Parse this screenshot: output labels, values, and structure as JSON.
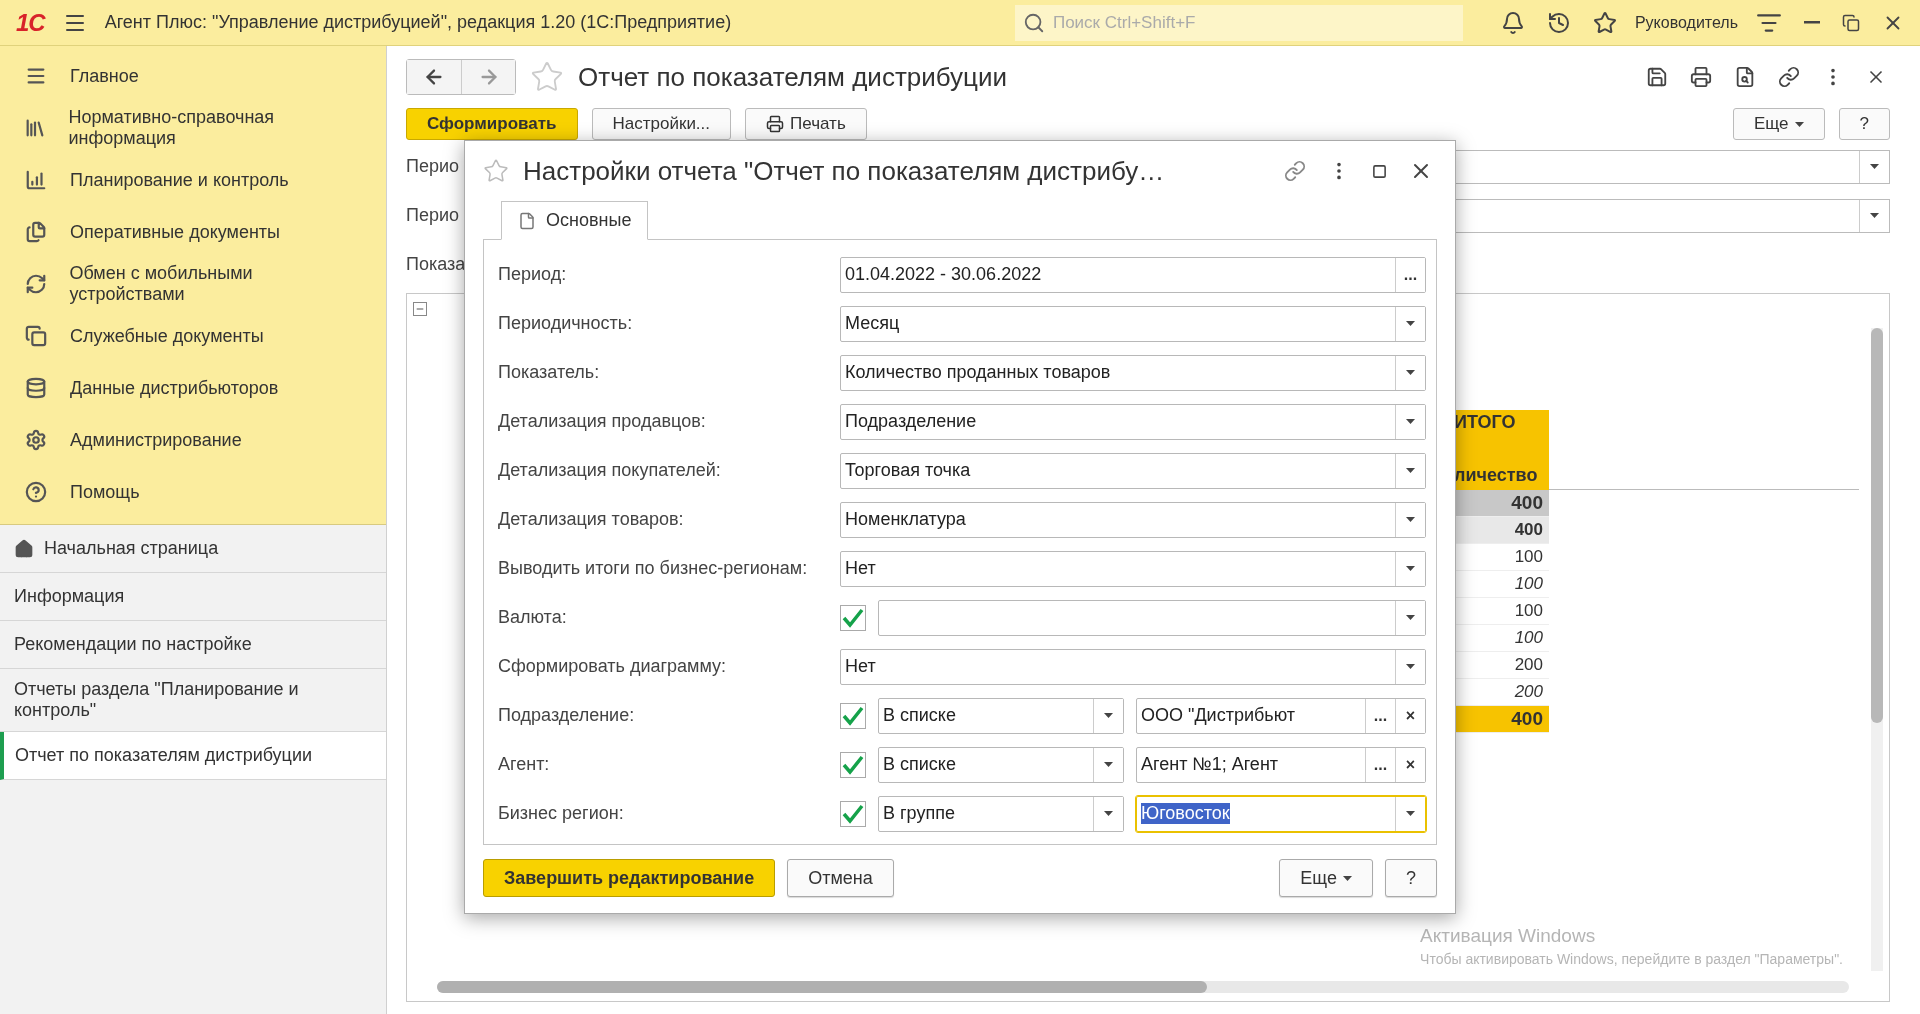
{
  "app": {
    "logo": "1С",
    "title": "Агент Плюс: \"Управление дистрибуцией\", редакция 1.20  (1С:Предприятие)",
    "search": {
      "placeholder": "Поиск Ctrl+Shift+F"
    },
    "user": "Руководитель"
  },
  "sidebar": {
    "sections": [
      {
        "label": "Главное",
        "kind": "menu"
      },
      {
        "label": "Нормативно-справочная информация",
        "kind": "catalog"
      },
      {
        "label": "Планирование и контроль",
        "kind": "chart"
      },
      {
        "label": "Оперативные документы",
        "kind": "docs"
      },
      {
        "label": "Обмен с мобильными устройствами",
        "kind": "sync"
      },
      {
        "label": "Служебные документы",
        "kind": "service"
      },
      {
        "label": "Данные дистрибьюторов",
        "kind": "data"
      },
      {
        "label": "Администрирование",
        "kind": "gear"
      },
      {
        "label": "Помощь",
        "kind": "help"
      }
    ],
    "open_windows": [
      {
        "label": "Начальная страница",
        "kind": "home",
        "selected": false
      },
      {
        "label": "Информация",
        "kind": "plain",
        "selected": false
      },
      {
        "label": "Рекомендации по настройке",
        "kind": "plain",
        "selected": false
      },
      {
        "label": "Отчеты раздела \"Планирование и контроль\"",
        "kind": "plain",
        "selected": false
      },
      {
        "label": "Отчет по показателям дистрибуции",
        "kind": "plain",
        "selected": true
      }
    ]
  },
  "form": {
    "title": "Отчет по показателям дистрибуции",
    "toolbar": [
      {
        "label": "Сформировать",
        "kind": "primary"
      },
      {
        "label": "Настройки...",
        "kind": "plain"
      },
      {
        "label": "Печать",
        "kind": "print"
      }
    ],
    "more": "Еще",
    "help": "?",
    "parameters": [
      {
        "label": "Перио",
        "kind": "select"
      },
      {
        "label": "Перио",
        "kind": "select"
      },
      {
        "label": "Показа",
        "kind": "text"
      }
    ],
    "report": {
      "total_header": "ИТОГО",
      "quantity_header": "личество",
      "rows": [
        {
          "value": "400",
          "kind": "total"
        },
        {
          "value": "400",
          "kind": "group"
        },
        {
          "value": "100",
          "kind": "plain"
        },
        {
          "value": "100",
          "kind": "italic"
        },
        {
          "value": "100",
          "kind": "plain"
        },
        {
          "value": "100",
          "kind": "italic"
        },
        {
          "value": "200",
          "kind": "plain"
        },
        {
          "value": "200",
          "kind": "italic"
        },
        {
          "value": "400",
          "kind": "grand"
        }
      ]
    }
  },
  "dialog": {
    "title": "Настройки отчета \"Отчет по показателям дистрибу…",
    "tabs": [
      {
        "label": "Основные",
        "selected": true
      }
    ],
    "rows": [
      {
        "label": "Период:",
        "kind": "field",
        "value": "01.04.2022 - 30.06.2022",
        "button_text": "..."
      },
      {
        "label": "Периодичность:",
        "kind": "field",
        "value": "Месяц"
      },
      {
        "label": "Показатель:",
        "kind": "field",
        "value": "Количество проданных товаров"
      },
      {
        "label": "Детализация продавцов:",
        "kind": "field",
        "value": "Подразделение"
      },
      {
        "label": "Детализация покупателей:",
        "kind": "field",
        "value": "Торговая точка"
      },
      {
        "label": "Детализация товаров:",
        "kind": "field",
        "value": "Номенклатура"
      },
      {
        "label": "Выводить итоги по бизнес-регионам:",
        "kind": "field",
        "value": "Нет"
      },
      {
        "label": "Валюта:",
        "kind": "check",
        "checked": true
      },
      {
        "label": "Сформировать диаграмму:",
        "kind": "field",
        "value": "Нет"
      },
      {
        "label": "Подразделение:",
        "kind": "filter",
        "checked": true,
        "condition": "В списке",
        "value": "ООО \"Дистрибьют",
        "button_text": "...",
        "clear": "×",
        "focused": false
      },
      {
        "label": "Агент:",
        "kind": "filter",
        "checked": true,
        "condition": "В списке",
        "value": "Агент №1; Агент",
        "button_text": "...",
        "clear": "×",
        "focused": false
      },
      {
        "label": "Бизнес регион:",
        "kind": "filter",
        "checked": true,
        "condition": "В группе",
        "value": "Юговосток",
        "focused": true
      }
    ],
    "buttons": {
      "finish": "Завершить редактирование",
      "cancel": "Отмена",
      "more": "Еще",
      "help": "?"
    }
  },
  "watermark": {
    "title": "Активация Windows",
    "text": "Чтобы активировать Windows, перейдите в раздел \"Параметры\"."
  }
}
